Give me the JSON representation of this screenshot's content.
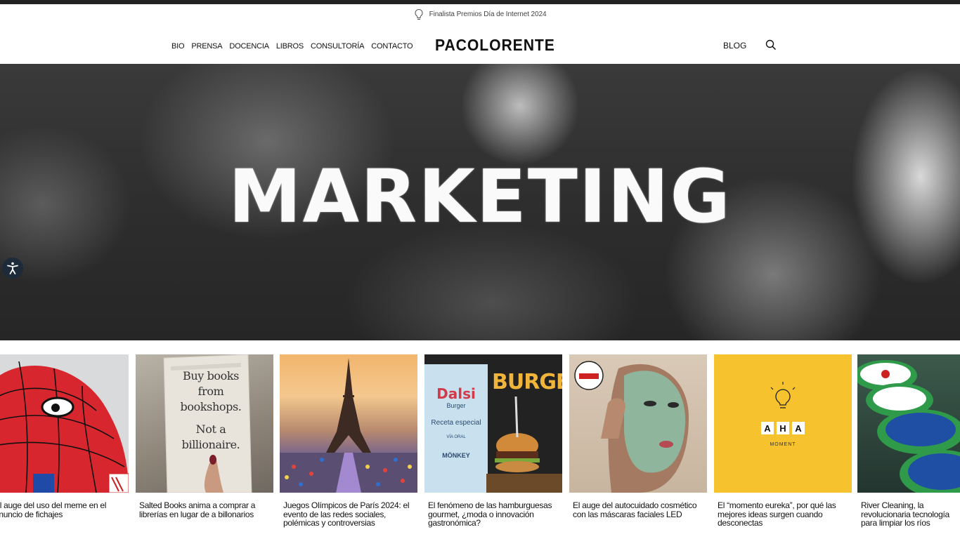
{
  "announcement": {
    "text": "Finalista Premios Día de Internet 2024",
    "icon": "lightbulb-icon"
  },
  "nav": {
    "items": [
      "BIO",
      "PRENSA",
      "DOCENCIA",
      "LIBROS",
      "CONSULTORÍA",
      "CONTACTO"
    ]
  },
  "logo": "PACOLORENTE",
  "blog_label": "BLOG",
  "hero": {
    "word": "MARKETING"
  },
  "articles": [
    {
      "title": "El auge del uso del meme en el anuncio de fichajes"
    },
    {
      "title": "Salted Books anima a comprar a librerías en lugar de a billonarios",
      "image_text": [
        "Buy books",
        "from bookshops.",
        "Not a billionaire."
      ]
    },
    {
      "title": "Juegos Olímpicos de París 2024: el evento de las redes sociales, polémicas y controversias"
    },
    {
      "title": "El fenómeno de las hamburguesas gourmet, ¿moda o innovación gastronómica?",
      "image_text": [
        "Dalsi",
        "Burger",
        "Receta especial",
        "VÍA ORAL",
        "MÖNKEY",
        "BURGER"
      ]
    },
    {
      "title": "El auge del autocuidado cosmético con las máscaras faciales LED"
    },
    {
      "title": "El “momento eureka”, por qué las mejores ideas surgen cuando desconectas",
      "image_text": [
        "A",
        "H",
        "A",
        "MOMENT"
      ]
    },
    {
      "title": "River Cleaning, la revolucionaria tecnología para limpiar los ríos"
    }
  ],
  "colors": {
    "top_bar": "#222222",
    "aha_yellow": "#f6c22e",
    "accessibility": "#1c2a3a"
  }
}
